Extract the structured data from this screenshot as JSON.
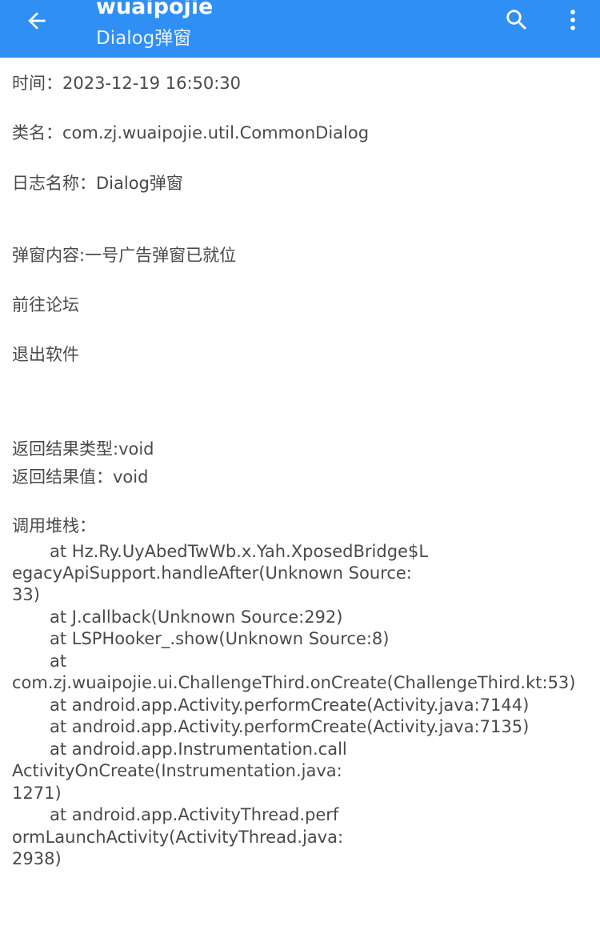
{
  "header": {
    "title": "wuaipojie",
    "subtitle": "Dialog弹窗",
    "accent_color": "#2f8ff5",
    "icons": {
      "back": "arrow-left-icon",
      "search": "search-icon",
      "more": "more-vertical-icon"
    }
  },
  "log": {
    "time": "时间：2023-12-19 16:50:30",
    "class_name": "类名：com.zj.wuaipojie.util.CommonDialog",
    "log_name": "日志名称：Dialog弹窗",
    "popup_content": "弹窗内容:一号广告弹窗已就位",
    "forum_link": "前往论坛",
    "exit_software": "退出软件",
    "return_type": "返回结果类型:void",
    "return_value": "返回结果值：void",
    "stack_header": "调用堆栈："
  },
  "stack": {
    "lines": [
      "at Hz.Ry.UyAbedTwWb.x.Yah.XposedBridge$L",
      "egacyApiSupport.handleAfter(Unknown Source:",
      "33)",
      "at J.callback(Unknown Source:292)",
      "at LSPHooker_.show(Unknown Source:8)",
      "at",
      "com.zj.wuaipojie.ui.ChallengeThird.onCreate(ChallengeThird.kt:53)",
      "at android.app.Activity.performCreate(Activity.java:7144)",
      "at android.app.Activity.performCreate(Activity.java:7135)",
      "at android.app.Instrumentation.call",
      "ActivityOnCreate(Instrumentation.java:",
      "1271)",
      "at android.app.ActivityThread.perf",
      "ormLaunchActivity(ActivityThread.java:",
      "2938)"
    ]
  }
}
